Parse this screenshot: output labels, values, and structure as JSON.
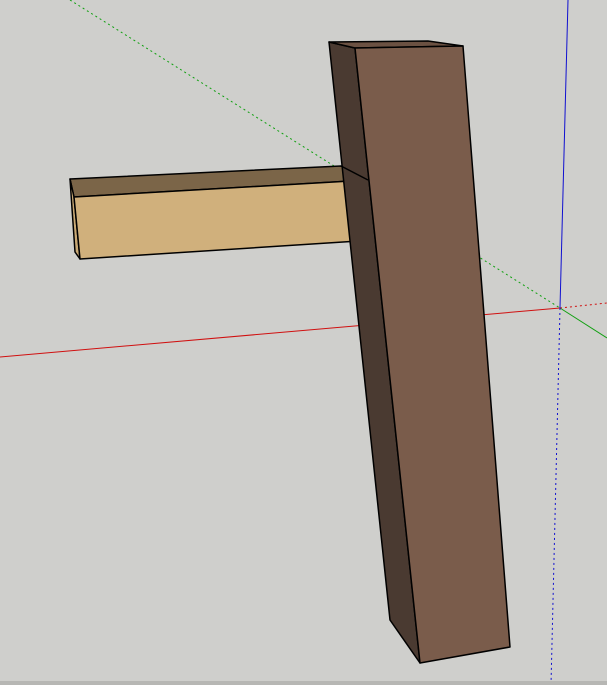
{
  "app": {
    "viewport_background": "#cfcfcc",
    "projection": "perspective"
  },
  "axes": {
    "red": {
      "name": "red-axis",
      "color": "#d01010"
    },
    "green": {
      "name": "green-axis",
      "color": "#10a010"
    },
    "blue": {
      "name": "blue-axis",
      "color": "#1010d0"
    }
  },
  "model": {
    "post": {
      "name": "vertical-post",
      "front_color": "#7a5c4b",
      "side_color": "#4a3a31",
      "top_color": "#6b5142"
    },
    "rail": {
      "name": "horizontal-rail",
      "front_color": "#d0b07c",
      "top_color": "#7b6548",
      "end_color": "#c9a975"
    },
    "edge_color": "#000000"
  }
}
